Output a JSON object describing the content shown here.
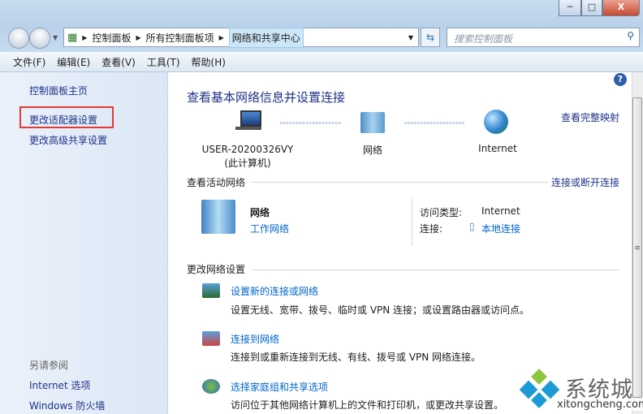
{
  "window": {
    "minimize": "─",
    "maximize": "□",
    "close": "X"
  },
  "address": {
    "crumbs": [
      "控制面板",
      "所有控制面板项",
      "网络和共享中心"
    ],
    "search_placeholder": "搜索控制面板"
  },
  "menu": [
    "文件(F)",
    "编辑(E)",
    "查看(V)",
    "工具(T)",
    "帮助(H)"
  ],
  "sidebar": {
    "home": "控制面板主页",
    "adapter": "更改适配器设置",
    "advanced": "更改高级共享设置",
    "see_also": "另请参阅",
    "internet_options": "Internet 选项",
    "firewall": "Windows 防火墙"
  },
  "main": {
    "title": "查看基本网络信息并设置连接",
    "full_map": "查看完整映射",
    "map": {
      "computer": "USER-20200326VY",
      "computer_sub": "(此计算机)",
      "network": "网络",
      "internet": "Internet"
    },
    "active_title": "查看活动网络",
    "connect_disconnect": "连接或断开连接",
    "active": {
      "name": "网络",
      "type": "工作网络",
      "access_label": "访问类型:",
      "access_value": "Internet",
      "conn_label": "连接:",
      "conn_value": "本地连接"
    },
    "change_title": "更改网络设置",
    "tasks": [
      {
        "link": "设置新的连接或网络",
        "desc": "设置无线、宽带、拨号、临时或 VPN 连接；或设置路由器或访问点。"
      },
      {
        "link": "连接到网络",
        "desc": "连接到或重新连接到无线、有线、拨号或 VPN 网络连接。"
      },
      {
        "link": "选择家庭组和共享选项",
        "desc": "访问位于其他网络计算机上的文件和打印机，或更改共享设置。"
      }
    ]
  },
  "watermark": {
    "cn": "系统城",
    "url": "xitongcheng.com"
  },
  "colors": {
    "link": "#1e3287",
    "highlight_box": "#e53935"
  }
}
